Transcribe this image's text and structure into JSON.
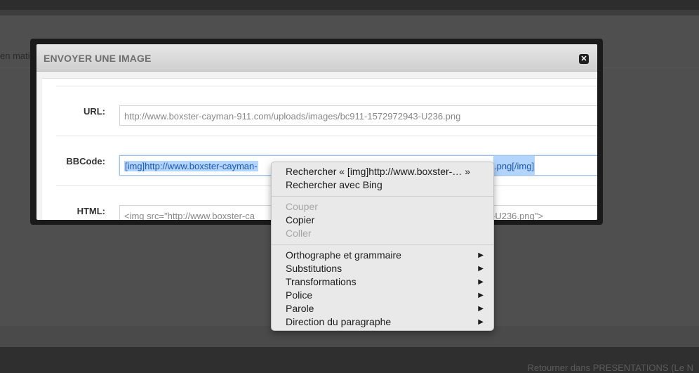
{
  "background": {
    "snippet_left": "en matie",
    "bottom_link": "Retourner dans PRESENTATIONS (Le N"
  },
  "modal": {
    "title": "ENVOYER UNE IMAGE",
    "close_icon": "close-icon",
    "fields": [
      {
        "label": "URL:",
        "value": "http://www.boxster-cayman-911.com/uploads/images/bc911-1572972943-U236.png"
      },
      {
        "label": "BBCode:",
        "value_start": "[img]http://www.boxster-cayman-",
        "value_end": ".png[/img]"
      },
      {
        "label": "HTML:",
        "value_start": "<img src=\"http://www.boxster-ca",
        "value_end": "-U236.png\">"
      }
    ]
  },
  "context_menu": {
    "groups": [
      [
        {
          "label": "Rechercher « [img]http://www.boxster-… »",
          "disabled": false
        },
        {
          "label": "Rechercher avec Bing",
          "disabled": false
        }
      ],
      [
        {
          "label": "Couper",
          "disabled": true
        },
        {
          "label": "Copier",
          "disabled": false
        },
        {
          "label": "Coller",
          "disabled": true
        }
      ],
      [
        {
          "label": "Orthographe et grammaire",
          "submenu": true
        },
        {
          "label": "Substitutions",
          "submenu": true
        },
        {
          "label": "Transformations",
          "submenu": true
        },
        {
          "label": "Police",
          "submenu": true
        },
        {
          "label": "Parole",
          "submenu": true
        },
        {
          "label": "Direction du paragraphe",
          "submenu": true
        }
      ]
    ],
    "submenu_arrow": "▶"
  }
}
